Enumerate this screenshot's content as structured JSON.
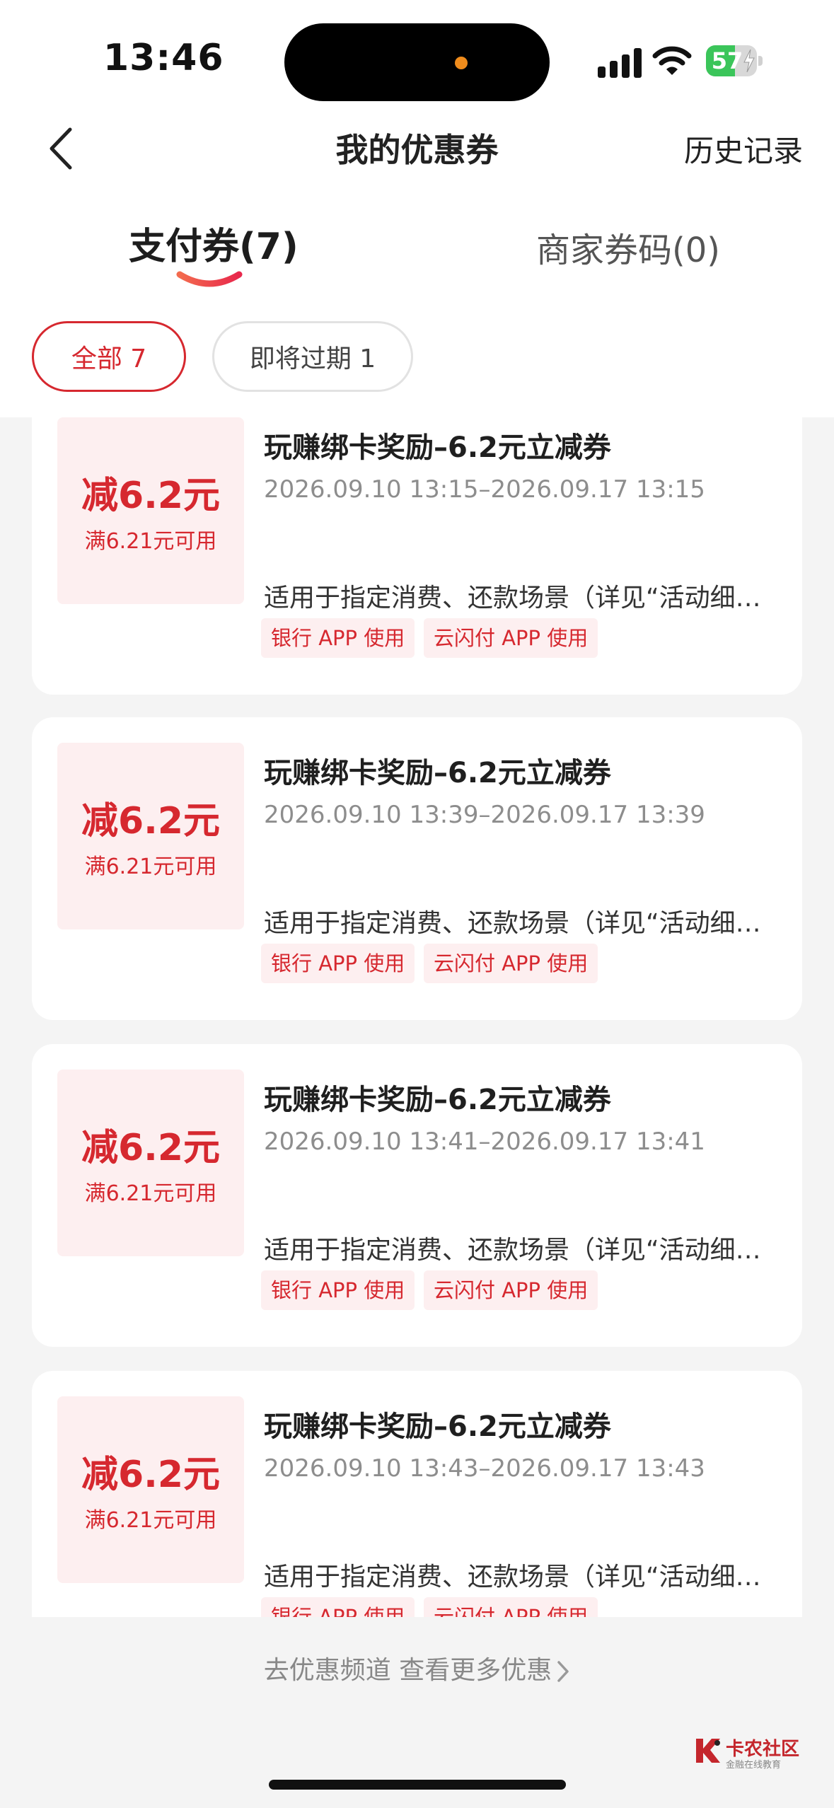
{
  "status_bar": {
    "time": "13:46",
    "battery": {
      "level": 57,
      "label": "57",
      "charging": true,
      "color": "#3bc55a"
    }
  },
  "nav": {
    "title": "我的优惠券",
    "history": "历史记录"
  },
  "tabs": [
    {
      "label": "支付券(7)",
      "active": true
    },
    {
      "label": "商家券码(0)",
      "active": false
    }
  ],
  "filters": [
    {
      "label": "全部 7",
      "selected": true
    },
    {
      "label": "即将过期 1",
      "selected": false
    }
  ],
  "coupons": [
    {
      "amount": "减6.2元",
      "condition": "满6.21元可用",
      "title": "玩赚绑卡奖励–6.2元立减券",
      "validity": "2026.09.10 13:15–2026.09.17 13:15",
      "description": "适用于指定消费、还款场景（详见“活动细…",
      "tags": [
        "银行 APP 使用",
        "云闪付 APP 使用"
      ]
    },
    {
      "amount": "减6.2元",
      "condition": "满6.21元可用",
      "title": "玩赚绑卡奖励–6.2元立减券",
      "validity": "2026.09.10 13:39–2026.09.17 13:39",
      "description": "适用于指定消费、还款场景（详见“活动细…",
      "tags": [
        "银行 APP 使用",
        "云闪付 APP 使用"
      ]
    },
    {
      "amount": "减6.2元",
      "condition": "满6.21元可用",
      "title": "玩赚绑卡奖励–6.2元立减券",
      "validity": "2026.09.10 13:41–2026.09.17 13:41",
      "description": "适用于指定消费、还款场景（详见“活动细…",
      "tags": [
        "银行 APP 使用",
        "云闪付 APP 使用"
      ]
    },
    {
      "amount": "减6.2元",
      "condition": "满6.21元可用",
      "title": "玩赚绑卡奖励–6.2元立减券",
      "validity": "2026.09.10 13:43–2026.09.17 13:43",
      "description": "适用于指定消费、还款场景（详见“活动细…",
      "tags": [
        "银行 APP 使用",
        "云闪付 APP 使用"
      ]
    }
  ],
  "footer": {
    "more": "去优惠频道 查看更多优惠"
  },
  "watermark": {
    "name": "卡农社区",
    "tagline": "金融在线教育"
  },
  "colors": {
    "accent": "#d6282f",
    "coupon_bg": "#fdeff0",
    "page_bg": "#f4f4f4"
  }
}
